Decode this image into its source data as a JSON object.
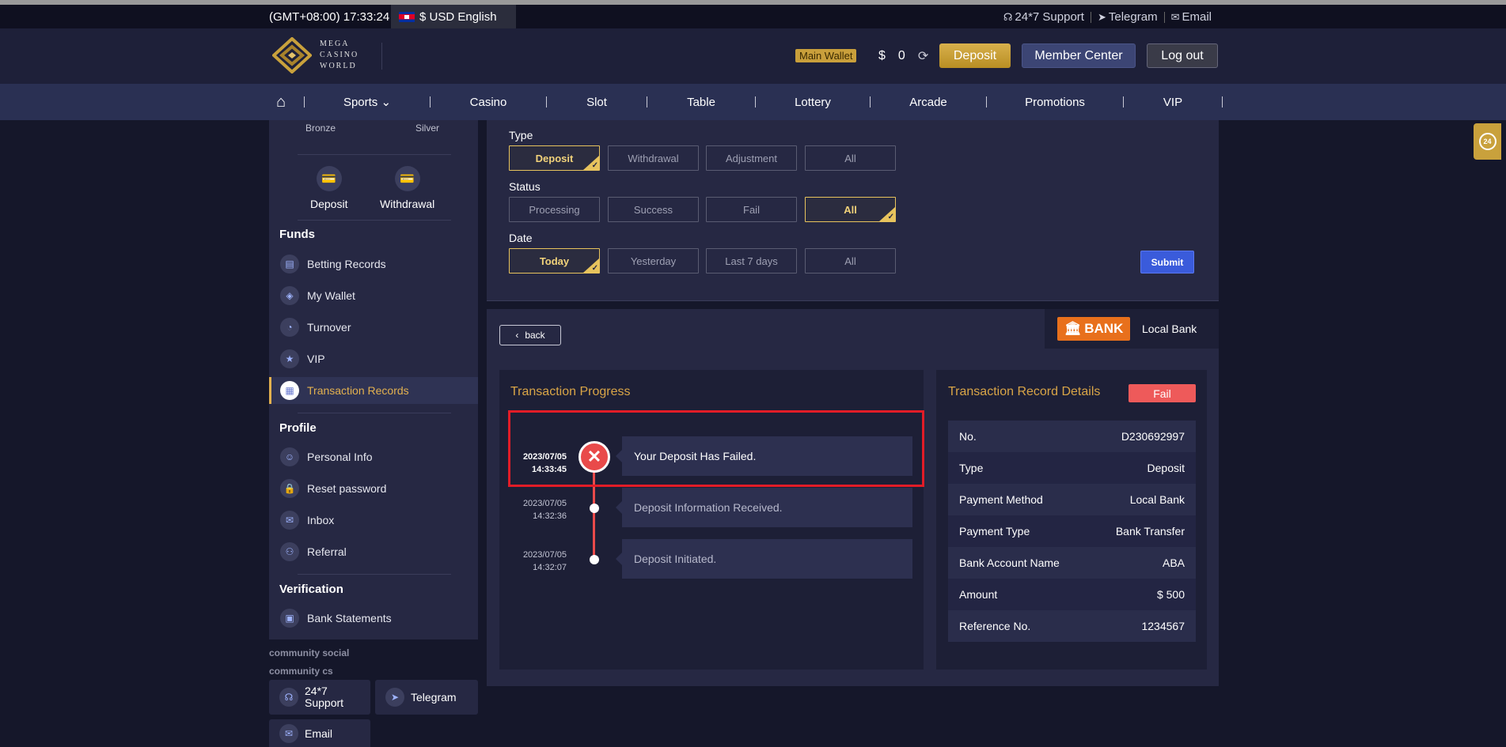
{
  "topbar": {
    "time": "(GMT+08:00) 17:33:24",
    "currency_lang": "$ USD English",
    "support": "24*7 Support",
    "telegram": "Telegram",
    "email": "Email"
  },
  "header": {
    "logo_line1": "MEGA",
    "logo_line2": "CASINO",
    "logo_line3": "WORLD",
    "wallet_label": "Main Wallet",
    "currency": "$",
    "balance": "0",
    "deposit_btn": "Deposit",
    "member_btn": "Member Center",
    "logout_btn": "Log out"
  },
  "nav": {
    "items": [
      "Sports",
      "Casino",
      "Slot",
      "Table",
      "Lottery",
      "Arcade",
      "Promotions",
      "VIP"
    ]
  },
  "sidebar": {
    "tier_left": "Bronze",
    "tier_right": "Silver",
    "quick_deposit": "Deposit",
    "quick_withdrawal": "Withdrawal",
    "funds_head": "Funds",
    "funds": [
      "Betting Records",
      "My Wallet",
      "Turnover",
      "VIP",
      "Transaction Records"
    ],
    "profile_head": "Profile",
    "profile": [
      "Personal Info",
      "Reset password",
      "Inbox",
      "Referral"
    ],
    "verification_head": "Verification",
    "verification": [
      "Bank Statements"
    ]
  },
  "community": {
    "social": "community social",
    "cs": "community cs",
    "support_line1": "24*7",
    "support_line2": "Support",
    "telegram": "Telegram",
    "email": "Email"
  },
  "filter": {
    "type_label": "Type",
    "type_options": [
      "Deposit",
      "Withdrawal",
      "Adjustment",
      "All"
    ],
    "status_label": "Status",
    "status_options": [
      "Processing",
      "Success",
      "Fail",
      "All"
    ],
    "date_label": "Date",
    "date_options": [
      "Today",
      "Yesterday",
      "Last 7 days",
      "All"
    ],
    "submit": "Submit"
  },
  "detail": {
    "back": "back",
    "bank_logo": "BANK",
    "bank_name": "Local Bank",
    "progress_title": "Transaction Progress",
    "timeline": [
      {
        "date": "2023/07/05",
        "time": "14:33:45",
        "message": "Your Deposit Has Failed."
      },
      {
        "date": "2023/07/05",
        "time": "14:32:36",
        "message": "Deposit Information Received."
      },
      {
        "date": "2023/07/05",
        "time": "14:32:07",
        "message": "Deposit Initiated."
      }
    ],
    "record_title": "Transaction Record Details",
    "status_badge": "Fail",
    "records": [
      {
        "label": "No.",
        "value": "D230692997"
      },
      {
        "label": "Type",
        "value": "Deposit"
      },
      {
        "label": "Payment Method",
        "value": "Local Bank"
      },
      {
        "label": "Payment Type",
        "value": "Bank Transfer"
      },
      {
        "label": "Bank Account Name",
        "value": "ABA"
      },
      {
        "label": "Amount",
        "value": "$ 500"
      },
      {
        "label": "Reference No.",
        "value": "1234567"
      }
    ]
  },
  "colors": {
    "gold": "#d9a547",
    "fail": "#ee5a5a",
    "nav_bg": "#2a3053",
    "panel_bg": "#262843"
  },
  "icons": {
    "home": "home-icon",
    "headset": "headset-icon",
    "telegram": "telegram-icon",
    "mail": "mail-icon",
    "refresh": "refresh-icon",
    "fail": "x-circle-icon",
    "side_help": "24h-support-icon"
  }
}
